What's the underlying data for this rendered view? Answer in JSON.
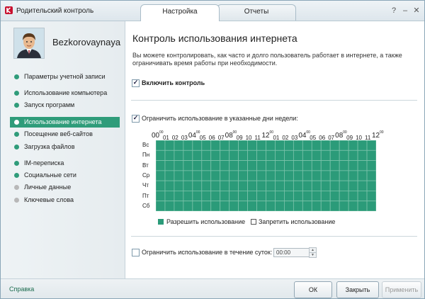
{
  "titlebar": {
    "app_title": "Родительский контроль",
    "tabs": [
      {
        "label": "Настройка",
        "active": true
      },
      {
        "label": "Отчеты",
        "active": false
      }
    ]
  },
  "sidebar": {
    "username": "Bezkorovaynaya",
    "items": [
      {
        "label": "Параметры учетной записи",
        "status": "green"
      },
      {
        "label": "Использование компьютера",
        "status": "green"
      },
      {
        "label": "Запуск программ",
        "status": "green"
      },
      {
        "label": "Использование интернета",
        "status": "green",
        "active": true
      },
      {
        "label": "Посещение веб-сайтов",
        "status": "green"
      },
      {
        "label": "Загрузка файлов",
        "status": "green"
      },
      {
        "label": "IM-переписка",
        "status": "green"
      },
      {
        "label": "Социальные сети",
        "status": "green"
      },
      {
        "label": "Личные данные",
        "status": "grey"
      },
      {
        "label": "Ключевые слова",
        "status": "grey"
      }
    ]
  },
  "main": {
    "title": "Контроль использования интернета",
    "description": "Вы можете контролировать, как часто и долго пользователь работает в интернете, а также ограничивать время работы при необходимости.",
    "enable_control": {
      "label": "Включить контроль",
      "checked": true
    },
    "limit_days": {
      "label": "Ограничить использование в указанные дни недели:",
      "checked": true
    },
    "schedule": {
      "days": [
        "Вс",
        "Пн",
        "Вт",
        "Ср",
        "Чт",
        "Пт",
        "Сб"
      ],
      "hour_labels": [
        "00",
        "01",
        "02",
        "03",
        "04",
        "05",
        "06",
        "07",
        "08",
        "09",
        "10",
        "11",
        "12",
        "01",
        "02",
        "03",
        "04",
        "05",
        "06",
        "07",
        "08",
        "09",
        "10",
        "11",
        "12"
      ],
      "minute_sup": "00",
      "allowed_color": "#2b9b79"
    },
    "legend": {
      "allow": "Разрешить использование",
      "deny": "Запретить использование"
    },
    "limit_daily": {
      "label": "Ограничить использование в течение суток:",
      "checked": false,
      "value": "00:00"
    }
  },
  "footer": {
    "help": "Справка",
    "ok": "ОК",
    "close": "Закрыть",
    "apply": "Применить"
  }
}
